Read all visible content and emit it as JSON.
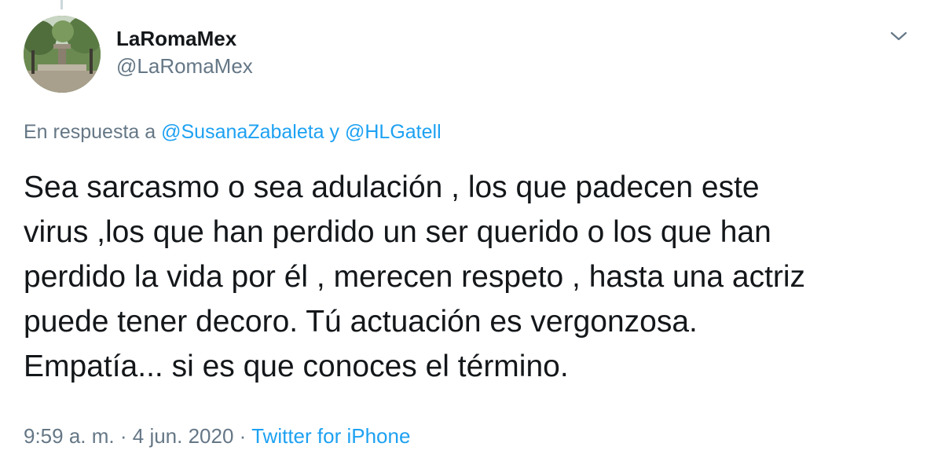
{
  "user": {
    "display_name": "LaRomaMex",
    "handle": "@LaRomaMex",
    "avatar": "park-photo-avatar"
  },
  "reply": {
    "prefix": "En respuesta a",
    "mention_1": "@SusanaZabaleta",
    "conjunction": "y",
    "mention_2": "@HLGatell"
  },
  "tweet": {
    "text": "Sea sarcasmo o sea adulación , los que padecen este\nvirus ,los que han perdido un ser querido o los que han\nperdido la vida por él , merecen respeto , hasta una actriz\npuede tener decoro. Tú actuación es vergonzosa.\nEmpatía... si es que conoces el término."
  },
  "meta": {
    "time": "9:59 a. m.",
    "separator_1": "·",
    "date": "4 jun. 2020",
    "separator_2": "·",
    "source": "Twitter for iPhone"
  },
  "icons": {
    "more": "chevron-down-icon"
  },
  "colors": {
    "link": "#1da1f2",
    "secondary_text": "#657786",
    "primary_text": "#14171a"
  }
}
